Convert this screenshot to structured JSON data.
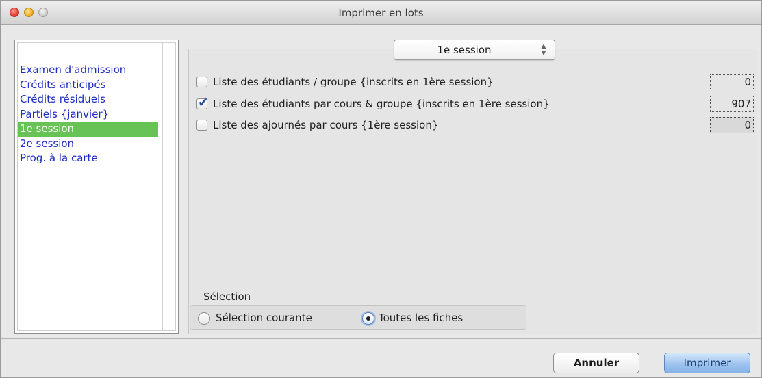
{
  "window": {
    "title": "Imprimer en lots"
  },
  "sidebar": {
    "items": [
      {
        "label": "Examen d'admission",
        "selected": false
      },
      {
        "label": "Crédits anticipés",
        "selected": false
      },
      {
        "label": "Crédits résiduels",
        "selected": false
      },
      {
        "label": "Partiels {janvier}",
        "selected": false
      },
      {
        "label": "1e session",
        "selected": true
      },
      {
        "label": "2e session",
        "selected": false
      },
      {
        "label": "Prog. à la carte",
        "selected": false
      }
    ]
  },
  "main": {
    "session_popup": {
      "value": "1e session"
    },
    "options": [
      {
        "label": "Liste des étudiants / groupe {inscrits en 1ère session}",
        "checked": false,
        "count": "0"
      },
      {
        "label": "Liste des étudiants par cours & groupe {inscrits en 1ère session}",
        "checked": true,
        "count": "907"
      },
      {
        "label": "Liste des ajournés par cours {1ère session}",
        "checked": false,
        "count": "0"
      }
    ],
    "selection": {
      "heading": "Sélection",
      "current_label": "Sélection courante",
      "all_label": "Toutes les fiches",
      "selected": "all"
    }
  },
  "buttons": {
    "cancel": "Annuler",
    "print": "Imprimer"
  },
  "colors": {
    "sidebar_selected": "#67c355",
    "link_text": "#1d2dbf",
    "default_button": "#9fc4ee"
  }
}
